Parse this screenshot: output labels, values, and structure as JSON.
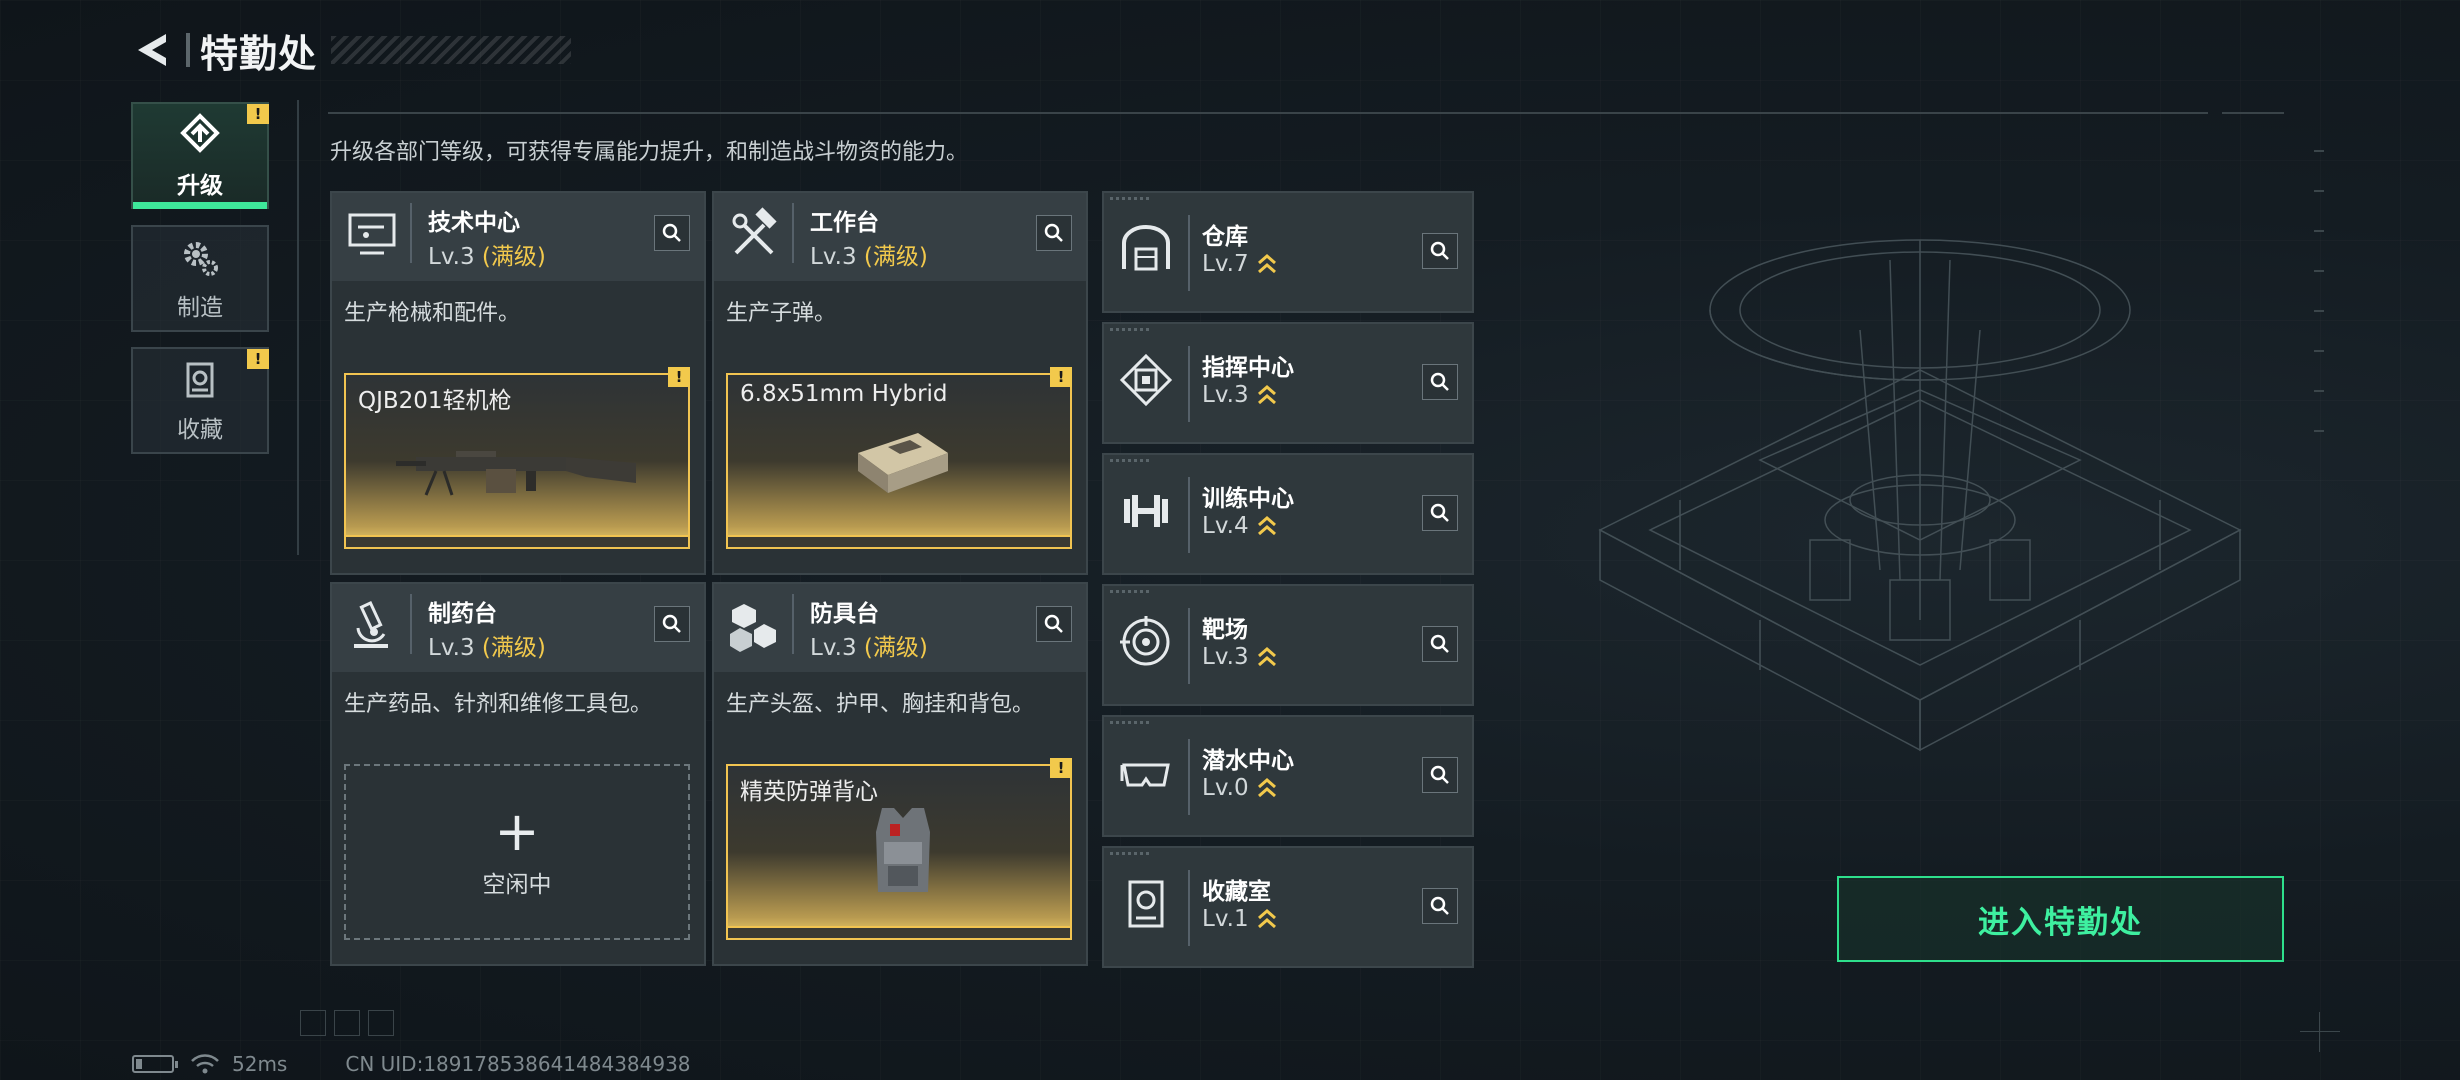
{
  "header": {
    "title": "特勤处"
  },
  "sidebar": {
    "tabs": [
      {
        "label": "升级",
        "active": true,
        "alert": "!"
      },
      {
        "label": "制造",
        "active": false
      },
      {
        "label": "收藏",
        "active": false,
        "alert": "!"
      }
    ]
  },
  "description": "升级各部门等级，可获得专属能力提升，和制造战斗物资的能力。",
  "workshops": [
    {
      "name": "技术中心",
      "level": "Lv.3",
      "max": "(满级)",
      "desc": "生产枪械和配件。",
      "product": {
        "name": "QJB201轻机枪",
        "alert": "!"
      }
    },
    {
      "name": "工作台",
      "level": "Lv.3",
      "max": "(满级)",
      "desc": "生产子弹。",
      "product": {
        "name": "6.8x51mm Hybrid",
        "alert": "!"
      }
    },
    {
      "name": "制药台",
      "level": "Lv.3",
      "max": "(满级)",
      "desc": "生产药品、针剂和维修工具包。",
      "idle": {
        "plus": "+",
        "label": "空闲中"
      }
    },
    {
      "name": "防具台",
      "level": "Lv.3",
      "max": "(满级)",
      "desc": "生产头盔、护甲、胸挂和背包。",
      "product": {
        "name": "精英防弹背心",
        "alert": "!"
      }
    }
  ],
  "facilities": [
    {
      "name": "仓库",
      "level": "Lv.7"
    },
    {
      "name": "指挥中心",
      "level": "Lv.3"
    },
    {
      "name": "训练中心",
      "level": "Lv.4"
    },
    {
      "name": "靶场",
      "level": "Lv.3"
    },
    {
      "name": "潜水中心",
      "level": "Lv.0"
    },
    {
      "name": "收藏室",
      "level": "Lv.1"
    }
  ],
  "enter_button": "进入特勤处",
  "footer": {
    "ping": "52ms",
    "uid": "CN UID:18917853864148438493​8"
  },
  "colors": {
    "accent_green": "#3ef0a0",
    "alert_yellow": "#f2c94c",
    "max_level": "#f2c94c"
  }
}
